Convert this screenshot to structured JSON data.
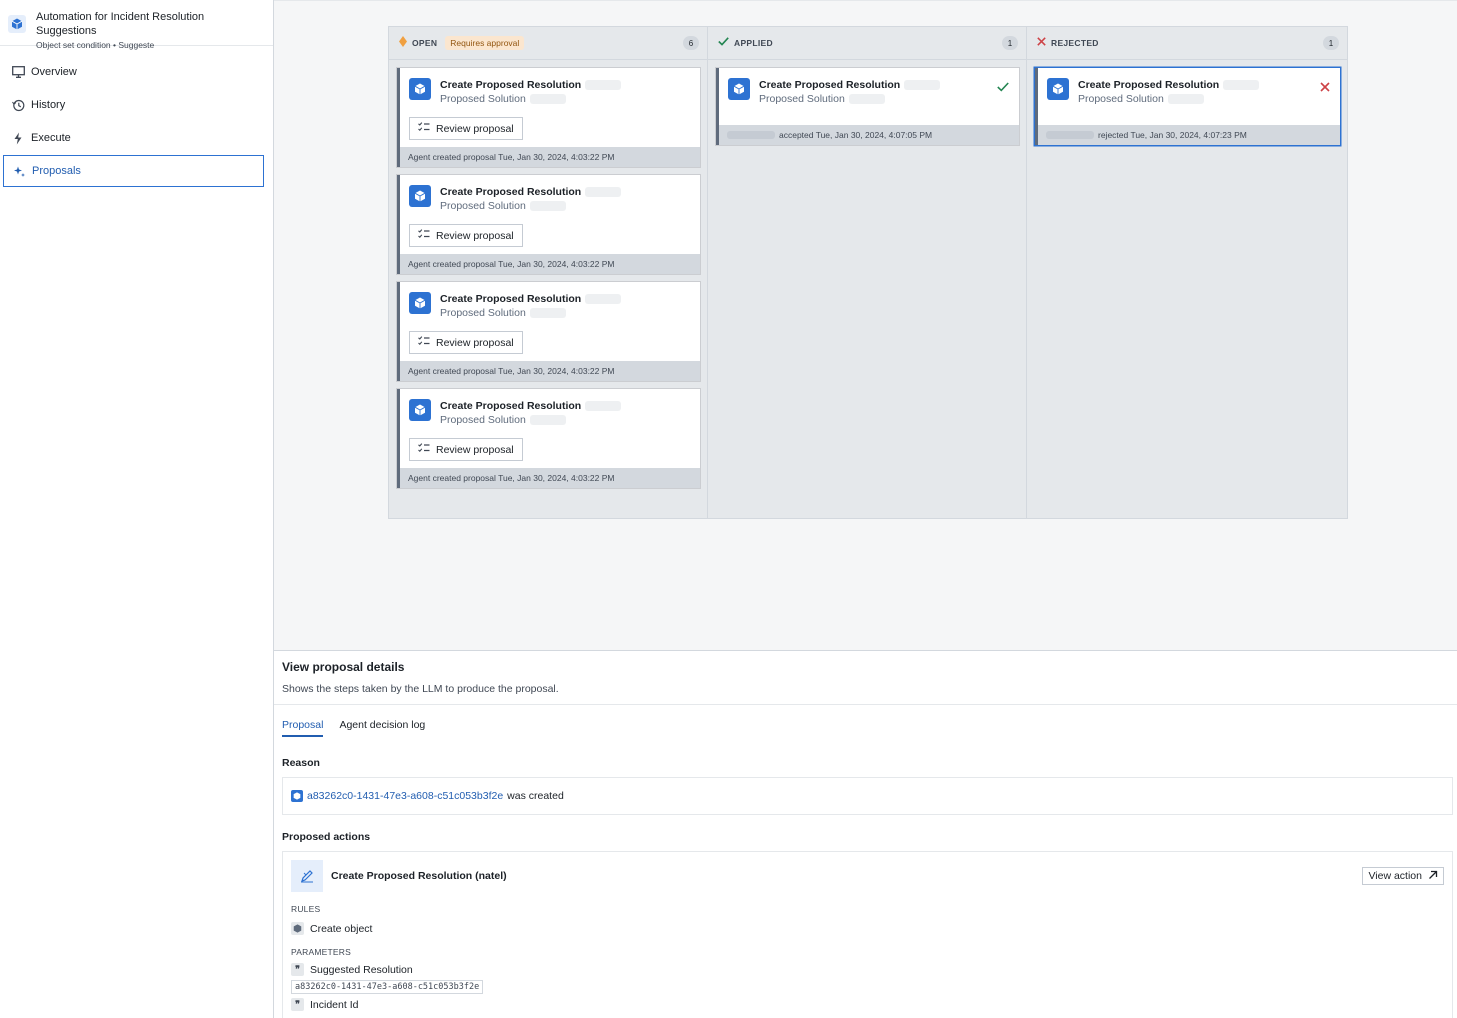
{
  "app": {
    "title": "Automation for Incident Resolution Suggestions",
    "subtitle": "Object set condition • Suggeste"
  },
  "nav": [
    {
      "label": "Overview",
      "icon": "monitor-icon"
    },
    {
      "label": "History",
      "icon": "history-icon"
    },
    {
      "label": "Execute",
      "icon": "lightning-icon"
    },
    {
      "label": "Proposals",
      "icon": "sparkle-icon",
      "active": true
    }
  ],
  "board": {
    "open": {
      "title": "OPEN",
      "badge": "Requires approval",
      "count": "6"
    },
    "applied": {
      "title": "APPLIED",
      "count": "1"
    },
    "rejected": {
      "title": "REJECTED",
      "count": "1"
    },
    "card_title": "Create Proposed Resolution",
    "card_sub": "Proposed Solution",
    "review_label": "Review proposal",
    "open_footer": "Agent created proposal Tue, Jan 30, 2024, 4:03:22 PM",
    "applied_footer": "accepted Tue, Jan 30, 2024, 4:07:05 PM",
    "rejected_footer": "rejected Tue, Jan 30, 2024, 4:07:23 PM"
  },
  "details": {
    "title": "View proposal details",
    "description": "Shows the steps taken by the LLM to produce the proposal.",
    "tabs": [
      "Proposal",
      "Agent decision log"
    ],
    "reason_label": "Reason",
    "reason_link": "a83262c0-1431-47e3-a608-c51c053b3f2e",
    "reason_suffix": "was created",
    "actions_label": "Proposed actions",
    "action_name": "Create Proposed Resolution (natel)",
    "view_action": "View action",
    "rules_label": "RULES",
    "rule": "Create object",
    "params_label": "PARAMETERS",
    "param1": "Suggested Resolution",
    "param1_value": "a83262c0-1431-47e3-a608-c51c053b3f2e",
    "param2": "Incident Id"
  },
  "colors": {
    "accent": "#2d72d2",
    "open": "#f0a041",
    "applied": "#238551",
    "rejected": "#cd4246"
  }
}
